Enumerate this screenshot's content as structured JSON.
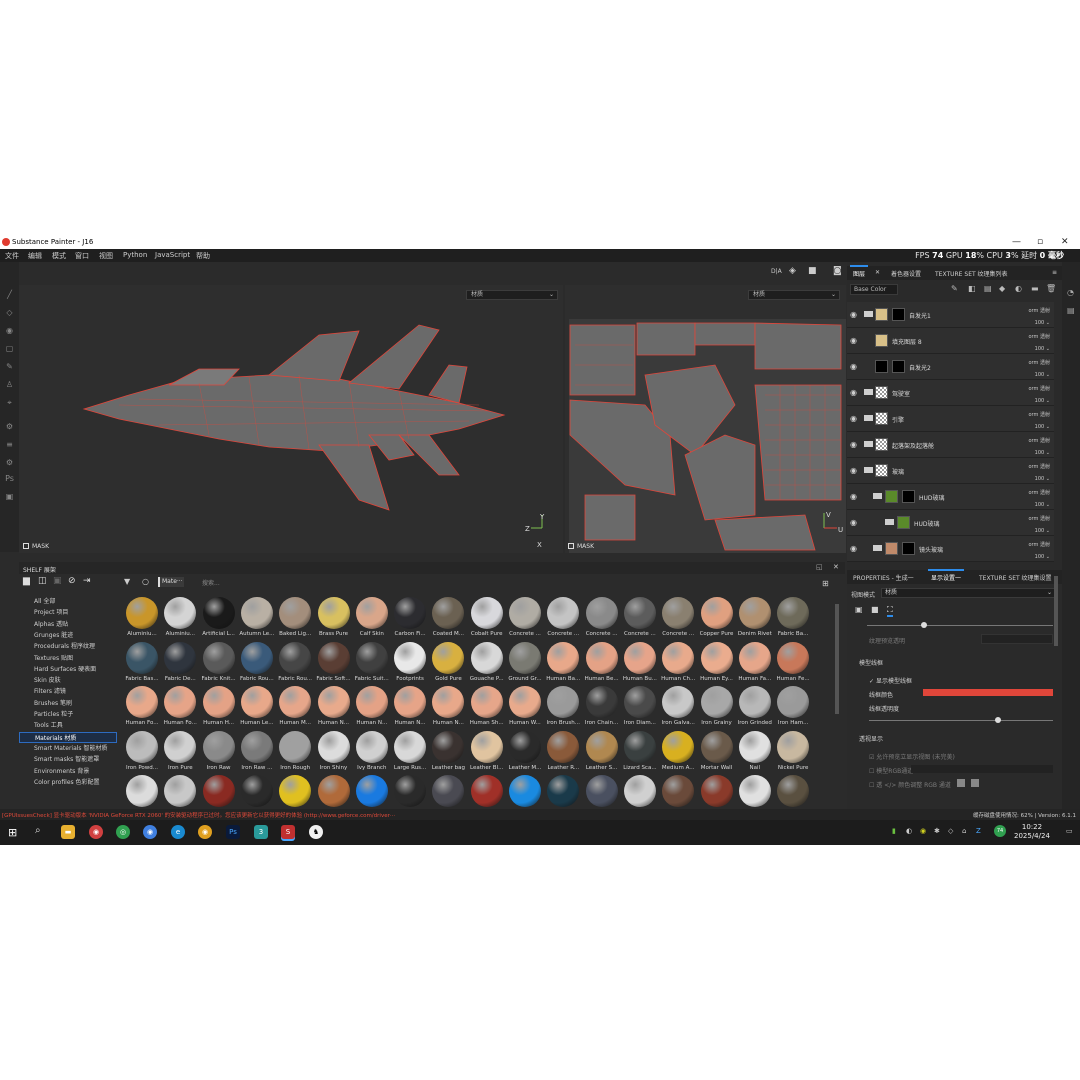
{
  "window": {
    "title": "Substance Painter - J16"
  },
  "menu": [
    "文件",
    "编辑",
    "模式",
    "窗口",
    "视图",
    "Python",
    "JavaScript",
    "帮助"
  ],
  "perf": {
    "fps_label": "FPS",
    "fps": "74",
    "gpu_label": "GPU",
    "gpu": "18",
    "cpu_label": "CPU",
    "cpu": "3",
    "latency_label": "延时",
    "latency": "0 毫秒"
  },
  "viewport3d": {
    "channel": "材质",
    "mask_label": "MASK"
  },
  "viewport2d": {
    "channel": "材质",
    "mask_label": "MASK"
  },
  "layers_panel": {
    "tabs": [
      "图层",
      "着色器设置",
      "TEXTURE SET 纹理集列表"
    ],
    "channel": "Base Color",
    "layers": [
      {
        "name": "自发光1",
        "blend": "orm 透射",
        "opacity": "100"
      },
      {
        "name": "填充图层 8",
        "blend": "orm 透射",
        "opacity": "100"
      },
      {
        "name": "自发光2",
        "blend": "orm 透射",
        "opacity": "100"
      },
      {
        "name": "驾驶室",
        "blend": "orm 透射",
        "opacity": "100"
      },
      {
        "name": "引擎",
        "blend": "orm 透射",
        "opacity": "100"
      },
      {
        "name": "起落架及起落舱",
        "blend": "orm 透射",
        "opacity": "100"
      },
      {
        "name": "玻璃",
        "blend": "orm 透射",
        "opacity": "100"
      },
      {
        "name": "HUD玻璃",
        "blend": "orm 透射",
        "opacity": "100"
      },
      {
        "name": "HUD玻璃",
        "blend": "orm 透射",
        "opacity": "100"
      },
      {
        "name": "镜头玻璃",
        "blend": "orm 透射",
        "opacity": "100"
      }
    ]
  },
  "properties_panel": {
    "tabs": [
      "PROPERTIES - 生成一",
      "显示设置一",
      "TEXTURE SET 纹理集设置"
    ],
    "view_mode_label": "视图模式",
    "view_mode": "材质",
    "env_exposure": "纹理预览透明",
    "wireframe_section": "模型线框",
    "show_wireframe": "显示模型线框",
    "wire_color": "线框颜色",
    "wire_opacity": "线框透明度",
    "wire_opacity_value": 0.7,
    "wire_color_hex": "#e0463a",
    "transparency_section": "透视显示",
    "transparency_opt1": "允许预览立显示视图 (未完美)",
    "transparency_opt2": "模型RGB通道",
    "transparency_opt3": "透 </> 颜色调整 RGB 通道"
  },
  "shelf": {
    "title": "SHELF 展架",
    "filter_chip": "Mate···",
    "search_placeholder": "搜索...",
    "categories": [
      "All 全部",
      "Project 项目",
      "Alphas 透贴",
      "Grunges 脏迹",
      "Procedurals 程序纹理",
      "Textures 贴图",
      "Hard Surfaces 硬表面",
      "Skin 皮肤",
      "Filters 滤镜",
      "Brushes 笔刷",
      "Particles 粒子",
      "Tools 工具",
      "Materials 材质",
      "Smart Materials 智能材质",
      "Smart masks 智能遮罩",
      "Environments 背景",
      "Color profiles 色彩配置"
    ],
    "active_category": "Materials 材质",
    "materials": [
      {
        "label": "Aluminiu...",
        "color": "#c9962a"
      },
      {
        "label": "Aluminiu...",
        "color": "#d4d4d4"
      },
      {
        "label": "Artificial L...",
        "color": "#1a1a1a"
      },
      {
        "label": "Autumn Le...",
        "color": "#b9b0a4"
      },
      {
        "label": "Baked Lig...",
        "color": "#a38e7c"
      },
      {
        "label": "Brass Pure",
        "color": "#d8c060"
      },
      {
        "label": "Calf Skin",
        "color": "#d9a68a"
      },
      {
        "label": "Carbon Fi...",
        "color": "#2c2c30"
      },
      {
        "label": "Coated M...",
        "color": "#6b6152"
      },
      {
        "label": "Cobalt Pure",
        "color": "#d8d8dc"
      },
      {
        "label": "Concrete ...",
        "color": "#b0aca4"
      },
      {
        "label": "Concrete ...",
        "color": "#c4c4c4"
      },
      {
        "label": "Concrete ...",
        "color": "#8a8a8a"
      },
      {
        "label": "Concrete ...",
        "color": "#5c5c5c"
      },
      {
        "label": "Concrete ...",
        "color": "#8a8070"
      },
      {
        "label": "Copper Pure",
        "color": "#e0a080"
      },
      {
        "label": "Denim Rivet",
        "color": "#b09070"
      },
      {
        "label": "Fabric Ba...",
        "color": "#6e6a5a"
      },
      {
        "label": "Fabric Bas...",
        "color": "#3a5566"
      },
      {
        "label": "Fabric De...",
        "color": "#2f353e"
      },
      {
        "label": "Fabric Knit...",
        "color": "#5a5a5a"
      },
      {
        "label": "Fabric Rou...",
        "color": "#3a5a7a"
      },
      {
        "label": "Fabric Rou...",
        "color": "#464646"
      },
      {
        "label": "Fabric Soft...",
        "color": "#5a3e34"
      },
      {
        "label": "Fabric Suit...",
        "color": "#404040"
      },
      {
        "label": "Footprints",
        "color": "#e8e8e8"
      },
      {
        "label": "Gold Pure",
        "color": "#d8b040"
      },
      {
        "label": "Gouache P...",
        "color": "#d8d8d8"
      },
      {
        "label": "Ground Gr...",
        "color": "#7a7a72"
      },
      {
        "label": "Human Ba...",
        "color": "#e8a88a"
      },
      {
        "label": "Human Be...",
        "color": "#e4a286"
      },
      {
        "label": "Human Bu...",
        "color": "#e6a48a"
      },
      {
        "label": "Human Ch...",
        "color": "#e8aa8c"
      },
      {
        "label": "Human Ey...",
        "color": "#eaac8e"
      },
      {
        "label": "Human Fa...",
        "color": "#e6a68a"
      },
      {
        "label": "Human Fe...",
        "color": "#c8785a"
      },
      {
        "label": "Human Fo...",
        "color": "#e8a88a"
      },
      {
        "label": "Human Fo...",
        "color": "#e6a488"
      },
      {
        "label": "Human H...",
        "color": "#e4a286"
      },
      {
        "label": "Human Le...",
        "color": "#e8a88a"
      },
      {
        "label": "Human M...",
        "color": "#e6a68a"
      },
      {
        "label": "Human N...",
        "color": "#e8aa8c"
      },
      {
        "label": "Human N...",
        "color": "#e4a286"
      },
      {
        "label": "Human N...",
        "color": "#e6a488"
      },
      {
        "label": "Human N...",
        "color": "#e8a88a"
      },
      {
        "label": "Human Sh...",
        "color": "#e6a68a"
      },
      {
        "label": "Human W...",
        "color": "#e8aa8c"
      },
      {
        "label": "Iron Brush...",
        "color": "#9a9a9a"
      },
      {
        "label": "Iron Chain...",
        "color": "#3a3a3a"
      },
      {
        "label": "Iron Diam...",
        "color": "#4a4a4a"
      },
      {
        "label": "Iron Galva...",
        "color": "#c8c8c8"
      },
      {
        "label": "Iron Grainy",
        "color": "#a8a8a8"
      },
      {
        "label": "Iron Grinded",
        "color": "#b8b8b8"
      },
      {
        "label": "Iron Ham...",
        "color": "#9a9a9a"
      },
      {
        "label": "Iron Powd...",
        "color": "#bcbcbc"
      },
      {
        "label": "Iron Pure",
        "color": "#d0d0d0"
      },
      {
        "label": "Iron Raw",
        "color": "#8a8a8a"
      },
      {
        "label": "Iron Raw ...",
        "color": "#7a7a7a"
      },
      {
        "label": "Iron Rough",
        "color": "#a0a0a0"
      },
      {
        "label": "Iron Shiny",
        "color": "#dcdcdc"
      },
      {
        "label": "Ivy Branch",
        "color": "#d0d0d0"
      },
      {
        "label": "Large Rus...",
        "color": "#d8d8d8"
      },
      {
        "label": "Leather bag",
        "color": "#3a3230"
      },
      {
        "label": "Leather Bl...",
        "color": "#e0c4a0"
      },
      {
        "label": "Leather M...",
        "color": "#2a2a2a"
      },
      {
        "label": "Leather R...",
        "color": "#8a5a3a"
      },
      {
        "label": "Leather S...",
        "color": "#b08850"
      },
      {
        "label": "Lizard Sca...",
        "color": "#3a4040"
      },
      {
        "label": "Medium A...",
        "color": "#d8b020"
      },
      {
        "label": "Mortar Wall",
        "color": "#6a5a4a"
      },
      {
        "label": "Nail",
        "color": "#e0e0e0"
      },
      {
        "label": "Nickel Pure",
        "color": "#c8b8a0"
      },
      {
        "label": "",
        "color": "#dcdcdc"
      },
      {
        "label": "",
        "color": "#c8c8c8"
      },
      {
        "label": "",
        "color": "#8a2a22"
      },
      {
        "label": "",
        "color": "#2a2a2a"
      },
      {
        "label": "",
        "color": "#e0c020"
      },
      {
        "label": "",
        "color": "#b06a3a"
      },
      {
        "label": "",
        "color": "#1a7ae0"
      },
      {
        "label": "",
        "color": "#2a2a2a"
      },
      {
        "label": "",
        "color": "#4a4a52"
      },
      {
        "label": "",
        "color": "#a03028"
      },
      {
        "label": "",
        "color": "#1a8ae0"
      },
      {
        "label": "",
        "color": "#1a3a4a"
      },
      {
        "label": "",
        "color": "#4a5060"
      },
      {
        "label": "",
        "color": "#d0d0d0"
      },
      {
        "label": "",
        "color": "#6a4a3a"
      },
      {
        "label": "",
        "color": "#8a3a2a"
      },
      {
        "label": "",
        "color": "#e0e0e0"
      },
      {
        "label": "",
        "color": "#5a5040"
      }
    ]
  },
  "status": {
    "error": "[GPUIssuesCheck] 显卡驱动版本 'NVIDIA GeForce RTX 2060' 的安装驱动程序已过时。您应该更新它以获得更好的体验 (http://www.geforce.com/driver···",
    "memory_label": "缓存磁盘使用情况:",
    "memory": "62%",
    "version": "Version: 6.1.1"
  },
  "taskbar": {
    "time": "10:22",
    "date": "2025/4/24",
    "badge": "74"
  }
}
